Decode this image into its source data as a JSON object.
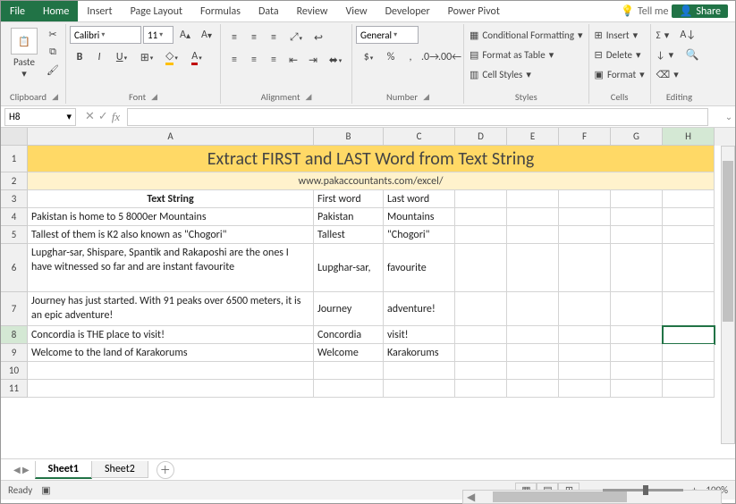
{
  "tabs": {
    "file": "File",
    "home": "Home",
    "insert": "Insert",
    "pageLayout": "Page Layout",
    "formulas": "Formulas",
    "data": "Data",
    "review": "Review",
    "view": "View",
    "developer": "Developer",
    "powerPivot": "Power Pivot",
    "tellme": "Tell me",
    "share": "Share"
  },
  "ribbon": {
    "clipboard": {
      "paste": "Paste",
      "label": "Clipboard"
    },
    "font": {
      "name": "Calibri",
      "size": "11",
      "label": "Font"
    },
    "alignment": {
      "label": "Alignment"
    },
    "number": {
      "format": "General",
      "label": "Number"
    },
    "styles": {
      "cond": "Conditional Formatting",
      "table": "Format as Table",
      "cell": "Cell Styles",
      "label": "Styles"
    },
    "cells": {
      "insert": "Insert",
      "delete": "Delete",
      "format": "Format",
      "label": "Cells"
    },
    "editing": {
      "label": "Editing"
    }
  },
  "namebox": "H8",
  "columns": [
    "A",
    "B",
    "C",
    "D",
    "E",
    "F",
    "G",
    "H"
  ],
  "sheet": {
    "title": "Extract FIRST and LAST Word from Text String",
    "subtitle": "www.pakaccountants.com/excel/",
    "h_text": "Text String",
    "h_first": "First word",
    "h_last": "Last word",
    "rows": [
      {
        "n": "4",
        "text": "Pakistan is home to 5 8000er Mountains",
        "first": "Pakistan",
        "last": "Mountains",
        "h": 20
      },
      {
        "n": "5",
        "text": "Tallest of them is K2 also known as \"Chogori\"",
        "first": "Tallest",
        "last": "\"Chogori\"",
        "h": 20
      },
      {
        "n": "6",
        "text": "Lupghar-sar, Shispare, Spantik and Rakaposhi are the ones I have witnessed so far and are instant favourite",
        "first": "Lupghar-sar,",
        "last": "favourite",
        "h": 54
      },
      {
        "n": "7",
        "text": "Journey has just started. With 91 peaks over 6500 meters, it is an epic adventure!",
        "first": "Journey",
        "last": "adventure!",
        "h": 38
      },
      {
        "n": "8",
        "text": "Concordia is THE place to visit!",
        "first": "Concordia",
        "last": "visit!",
        "h": 20
      },
      {
        "n": "9",
        "text": "Welcome to the land of Karakorums",
        "first": "Welcome",
        "last": "Karakorums",
        "h": 20
      }
    ],
    "empty": [
      "10",
      "11"
    ]
  },
  "sheets": {
    "s1": "Sheet1",
    "s2": "Sheet2"
  },
  "status": {
    "ready": "Ready",
    "zoom": "100%"
  },
  "chart_data": {
    "type": "table",
    "title": "Extract FIRST and LAST Word from Text String",
    "columns": [
      "Text String",
      "First word",
      "Last word"
    ],
    "data": [
      [
        "Pakistan is home to 5 8000er Mountains",
        "Pakistan",
        "Mountains"
      ],
      [
        "Tallest of them is K2 also known as \"Chogori\"",
        "Tallest",
        "\"Chogori\""
      ],
      [
        "Lupghar-sar, Shispare, Spantik and Rakaposhi are the ones I have witnessed so far and are instant favourite",
        "Lupghar-sar,",
        "favourite"
      ],
      [
        "Journey has just started. With 91 peaks over 6500 meters, it is an epic adventure!",
        "Journey",
        "adventure!"
      ],
      [
        "Concordia is THE place to visit!",
        "Concordia",
        "visit!"
      ],
      [
        "Welcome to the land of Karakorums",
        "Welcome",
        "Karakorums"
      ]
    ]
  }
}
